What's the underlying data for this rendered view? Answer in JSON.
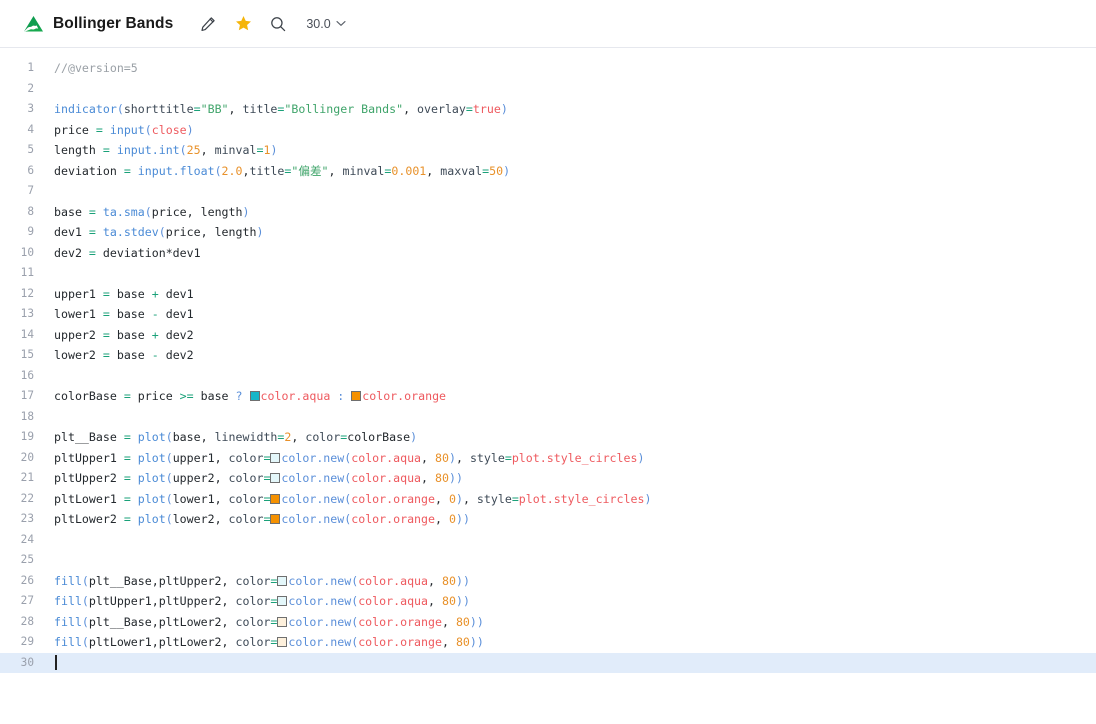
{
  "header": {
    "logo_icon": "mountain-logo-icon",
    "title": "Bollinger Bands",
    "edit_icon": "pencil-icon",
    "favorite_icon": "star-icon",
    "search_icon": "search-icon",
    "version_label": "30.0",
    "version_chevron_icon": "chevron-down-icon"
  },
  "colors": {
    "brand_green": "#15a94e",
    "star_gold": "#f5b90b",
    "aqua": "#16b6c8",
    "orange": "#f59100",
    "aqua_80": "#e4f7fa",
    "orange_80": "#fdf0dc",
    "active_line": "#e1ecfa",
    "comment": "#9aa0a6",
    "string": "#3fa46a",
    "number": "#e8912a",
    "keyword": "#ee5a5f",
    "function": "#4b8bd6",
    "operator": "#1aa179"
  },
  "editor": {
    "active_line": 30,
    "total_lines": 30,
    "lines": [
      {
        "n": 1,
        "text": "//@version=5"
      },
      {
        "n": 2,
        "text": ""
      },
      {
        "n": 3,
        "text": "indicator(shorttitle=\"BB\", title=\"Bollinger Bands\", overlay=true)"
      },
      {
        "n": 4,
        "text": "price = input(close)"
      },
      {
        "n": 5,
        "text": "length = input.int(25, minval=1)"
      },
      {
        "n": 6,
        "text": "deviation = input.float(2.0,title=\"偏差\", minval=0.001, maxval=50)"
      },
      {
        "n": 7,
        "text": ""
      },
      {
        "n": 8,
        "text": "base = ta.sma(price, length)"
      },
      {
        "n": 9,
        "text": "dev1 = ta.stdev(price, length)"
      },
      {
        "n": 10,
        "text": "dev2 = deviation*dev1"
      },
      {
        "n": 11,
        "text": ""
      },
      {
        "n": 12,
        "text": "upper1 = base + dev1"
      },
      {
        "n": 13,
        "text": "lower1 = base - dev1"
      },
      {
        "n": 14,
        "text": "upper2 = base + dev2"
      },
      {
        "n": 15,
        "text": "lower2 = base - dev2"
      },
      {
        "n": 16,
        "text": ""
      },
      {
        "n": 17,
        "text": "colorBase = price >= base ? color.aqua : color.orange"
      },
      {
        "n": 18,
        "text": ""
      },
      {
        "n": 19,
        "text": "plt__Base = plot(base, linewidth=2, color=colorBase)"
      },
      {
        "n": 20,
        "text": "pltUpper1 = plot(upper1, color=color.new(color.aqua, 80), style=plot.style_circles)"
      },
      {
        "n": 21,
        "text": "pltUpper2 = plot(upper2, color=color.new(color.aqua, 80))"
      },
      {
        "n": 22,
        "text": "pltLower1 = plot(lower1, color=color.new(color.orange, 0), style=plot.style_circles)"
      },
      {
        "n": 23,
        "text": "pltLower2 = plot(lower2, color=color.new(color.orange, 0))"
      },
      {
        "n": 24,
        "text": ""
      },
      {
        "n": 25,
        "text": ""
      },
      {
        "n": 26,
        "text": "fill(plt__Base,pltUpper2, color=color.new(color.aqua, 80))"
      },
      {
        "n": 27,
        "text": "fill(pltUpper1,pltUpper2, color=color.new(color.aqua, 80))"
      },
      {
        "n": 28,
        "text": "fill(plt__Base,pltLower2, color=color.new(color.orange, 80))"
      },
      {
        "n": 29,
        "text": "fill(pltLower1,pltLower2, color=color.new(color.orange, 80))"
      },
      {
        "n": 30,
        "text": ""
      }
    ],
    "tokens": {
      "l1": [
        [
          "//@version=5",
          "t-com"
        ]
      ],
      "l3": [
        [
          "indicator",
          "t-fn"
        ],
        [
          "(",
          "t-punc"
        ],
        [
          "shorttitle",
          "t-par"
        ],
        [
          "=",
          "t-op"
        ],
        [
          "\"BB\"",
          "t-str"
        ],
        [
          ", ",
          "t-plain"
        ],
        [
          "title",
          "t-par"
        ],
        [
          "=",
          "t-op"
        ],
        [
          "\"Bollinger Bands\"",
          "t-str"
        ],
        [
          ", ",
          "t-plain"
        ],
        [
          "overlay",
          "t-par"
        ],
        [
          "=",
          "t-op"
        ],
        [
          "true",
          "t-kw"
        ],
        [
          ")",
          "t-punc"
        ]
      ],
      "l4": [
        [
          "price",
          "t-var"
        ],
        [
          " ",
          "t-plain"
        ],
        [
          "=",
          "t-op"
        ],
        [
          " ",
          "t-plain"
        ],
        [
          "input",
          "t-fn"
        ],
        [
          "(",
          "t-punc"
        ],
        [
          "close",
          "t-kw"
        ],
        [
          ")",
          "t-punc"
        ]
      ],
      "l5": [
        [
          "length",
          "t-var"
        ],
        [
          " ",
          "t-plain"
        ],
        [
          "=",
          "t-op"
        ],
        [
          " ",
          "t-plain"
        ],
        [
          "input.int",
          "t-fn"
        ],
        [
          "(",
          "t-punc"
        ],
        [
          "25",
          "t-num"
        ],
        [
          ", ",
          "t-plain"
        ],
        [
          "minval",
          "t-par"
        ],
        [
          "=",
          "t-op"
        ],
        [
          "1",
          "t-num"
        ],
        [
          ")",
          "t-punc"
        ]
      ],
      "l6": [
        [
          "deviation",
          "t-var"
        ],
        [
          " ",
          "t-plain"
        ],
        [
          "=",
          "t-op"
        ],
        [
          " ",
          "t-plain"
        ],
        [
          "input.float",
          "t-fn"
        ],
        [
          "(",
          "t-punc"
        ],
        [
          "2.0",
          "t-num"
        ],
        [
          ",",
          "t-plain"
        ],
        [
          "title",
          "t-par"
        ],
        [
          "=",
          "t-op"
        ],
        [
          "\"偏差\"",
          "t-str"
        ],
        [
          ", ",
          "t-plain"
        ],
        [
          "minval",
          "t-par"
        ],
        [
          "=",
          "t-op"
        ],
        [
          "0.001",
          "t-num"
        ],
        [
          ", ",
          "t-plain"
        ],
        [
          "maxval",
          "t-par"
        ],
        [
          "=",
          "t-op"
        ],
        [
          "50",
          "t-num"
        ],
        [
          ")",
          "t-punc"
        ]
      ],
      "l8": [
        [
          "base",
          "t-var"
        ],
        [
          " ",
          "t-plain"
        ],
        [
          "=",
          "t-op"
        ],
        [
          " ",
          "t-plain"
        ],
        [
          "ta.sma",
          "t-fn"
        ],
        [
          "(",
          "t-punc"
        ],
        [
          "price, length",
          "t-plain"
        ],
        [
          ")",
          "t-punc"
        ]
      ],
      "l9": [
        [
          "dev1",
          "t-var"
        ],
        [
          " ",
          "t-plain"
        ],
        [
          "=",
          "t-op"
        ],
        [
          " ",
          "t-plain"
        ],
        [
          "ta.stdev",
          "t-fn"
        ],
        [
          "(",
          "t-punc"
        ],
        [
          "price, length",
          "t-plain"
        ],
        [
          ")",
          "t-punc"
        ]
      ],
      "l10": [
        [
          "dev2",
          "t-var"
        ],
        [
          " ",
          "t-plain"
        ],
        [
          "=",
          "t-op"
        ],
        [
          " ",
          "t-plain"
        ],
        [
          "deviation*dev1",
          "t-plain"
        ]
      ],
      "l12": [
        [
          "upper1",
          "t-var"
        ],
        [
          " ",
          "t-plain"
        ],
        [
          "=",
          "t-op"
        ],
        [
          " base ",
          "t-plain"
        ],
        [
          "+",
          "t-op"
        ],
        [
          " dev1",
          "t-plain"
        ]
      ],
      "l13": [
        [
          "lower1",
          "t-var"
        ],
        [
          " ",
          "t-plain"
        ],
        [
          "=",
          "t-op"
        ],
        [
          " base ",
          "t-plain"
        ],
        [
          "-",
          "t-op"
        ],
        [
          " dev1",
          "t-plain"
        ]
      ],
      "l14": [
        [
          "upper2",
          "t-var"
        ],
        [
          " ",
          "t-plain"
        ],
        [
          "=",
          "t-op"
        ],
        [
          " base ",
          "t-plain"
        ],
        [
          "+",
          "t-op"
        ],
        [
          " dev2",
          "t-plain"
        ]
      ],
      "l15": [
        [
          "lower2",
          "t-var"
        ],
        [
          " ",
          "t-plain"
        ],
        [
          "=",
          "t-op"
        ],
        [
          " base ",
          "t-plain"
        ],
        [
          "-",
          "t-op"
        ],
        [
          " dev2",
          "t-plain"
        ]
      ]
    }
  }
}
